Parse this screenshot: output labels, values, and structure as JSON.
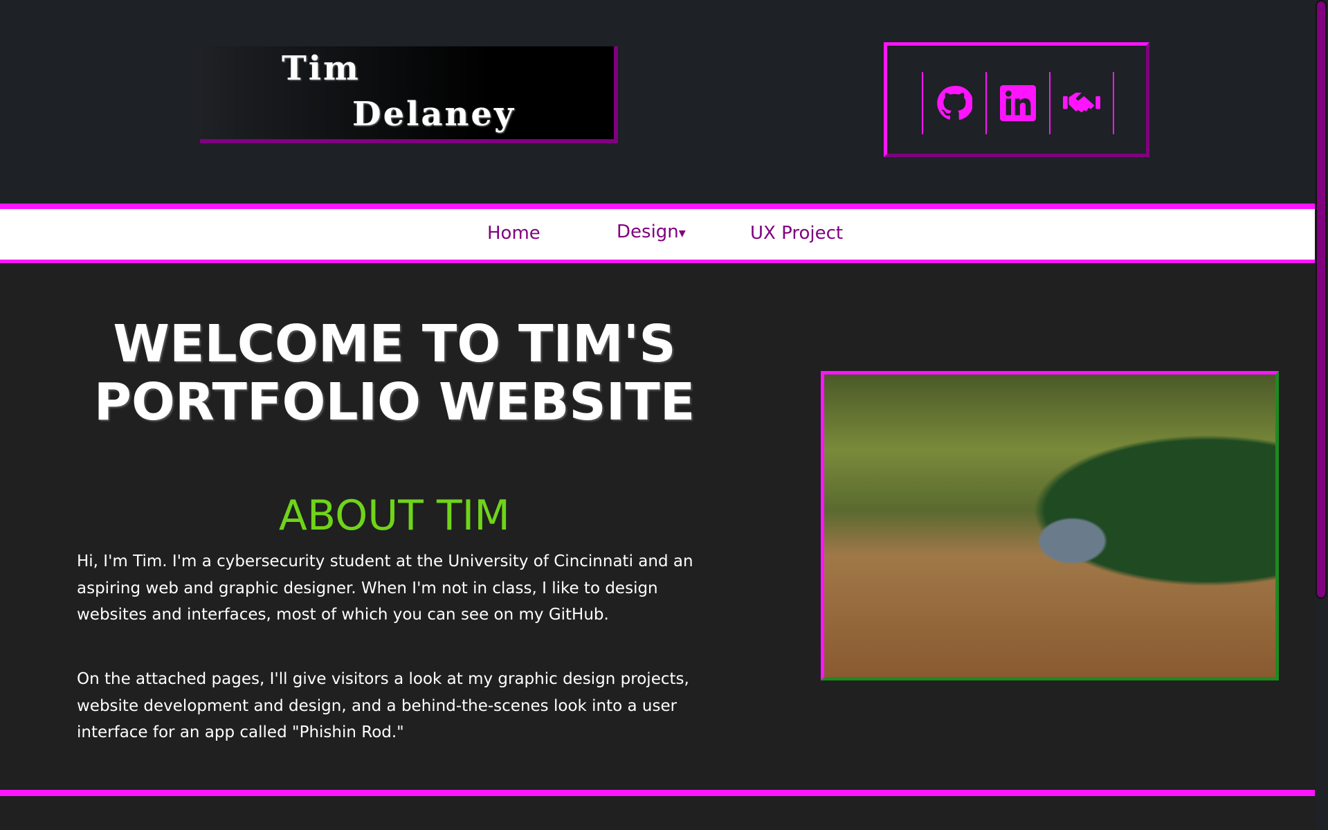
{
  "logo": {
    "line1": "Tim",
    "line2": "Delaney"
  },
  "social": {
    "items": [
      {
        "icon": "github-icon"
      },
      {
        "icon": "linkedin-icon"
      },
      {
        "icon": "handshake-icon"
      }
    ]
  },
  "nav": {
    "items": [
      {
        "label": "Home"
      },
      {
        "label": "Design",
        "caret": "▾"
      },
      {
        "label": "UX Project"
      }
    ]
  },
  "main": {
    "title": "WELCOME TO TIM'S PORTFOLIO WEBSITE",
    "about_heading": "ABOUT TIM",
    "paragraphs": [
      "Hi, I'm Tim. I'm a cybersecurity student at the University of Cincinnati and an aspiring web and graphic designer. When I'm not in class, I like to design websites and interfaces, most of which you can see on my GitHub.",
      "On the attached pages, I'll give visitors a look at my graphic design projects, website development and design, and a behind-the-scenes look into a user interface for an app called \"Phishin Rod.\""
    ]
  },
  "colors": {
    "accent": "#ff14ff",
    "purple": "#800080",
    "green": "#6fd41a",
    "background": "#202020"
  }
}
